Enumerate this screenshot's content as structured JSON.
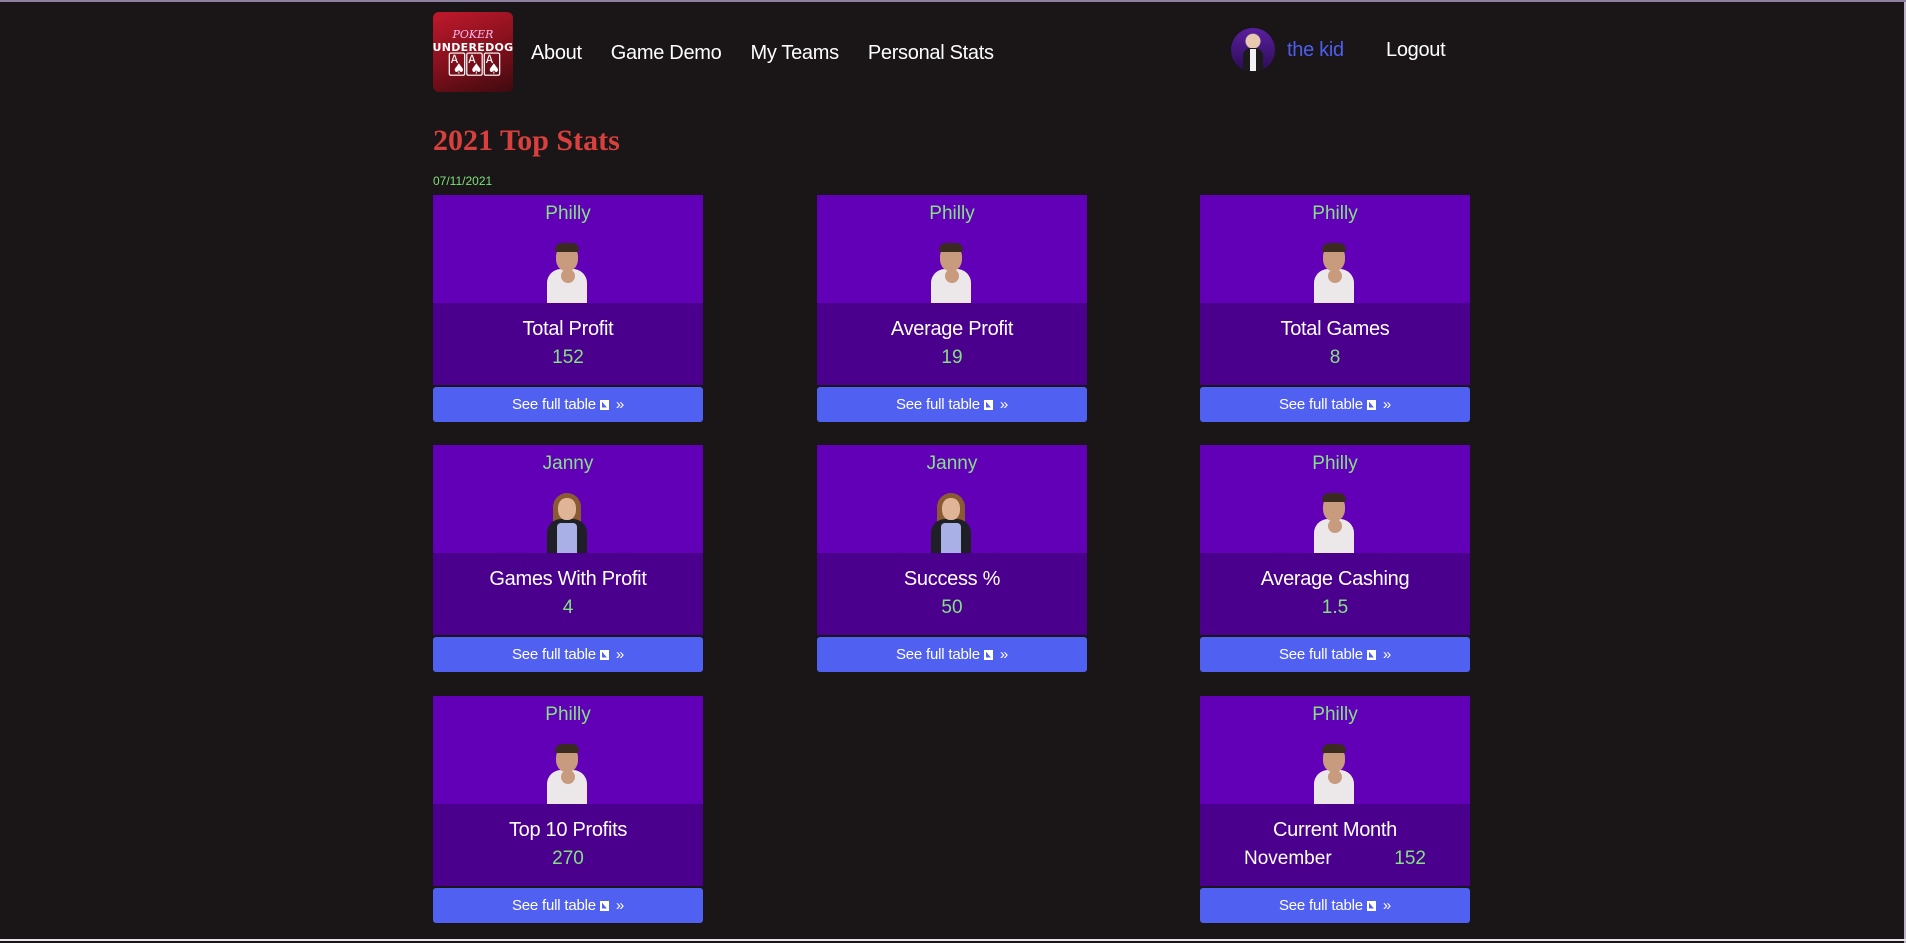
{
  "logo": {
    "line1": "POKER",
    "line2": "UNDEREDOG",
    "line3": "🂡🂡🂡"
  },
  "nav": {
    "links": [
      "About",
      "Game Demo",
      "My Teams",
      "Personal Stats"
    ],
    "username": "the kid",
    "logout": "Logout"
  },
  "page": {
    "title": "2021 Top Stats",
    "date": "07/11/2021"
  },
  "button_label": "See full table",
  "button_arrow": "»",
  "cards": [
    {
      "player": "Philly",
      "label": "Total Profit",
      "value": "152"
    },
    {
      "player": "Philly",
      "label": "Average Profit",
      "value": "19"
    },
    {
      "player": "Philly",
      "label": "Total Games",
      "value": "8"
    },
    {
      "player": "Janny",
      "label": "Games With Profit",
      "value": "4"
    },
    {
      "player": "Janny",
      "label": "Success %",
      "value": "50"
    },
    {
      "player": "Philly",
      "label": "Average Cashing",
      "value": "1.5"
    },
    {
      "player": "Philly",
      "label": "Top 10 Profits",
      "value": "270"
    },
    {
      "player": "Philly",
      "label": "Current Month",
      "month": "November",
      "value": "152"
    }
  ]
}
